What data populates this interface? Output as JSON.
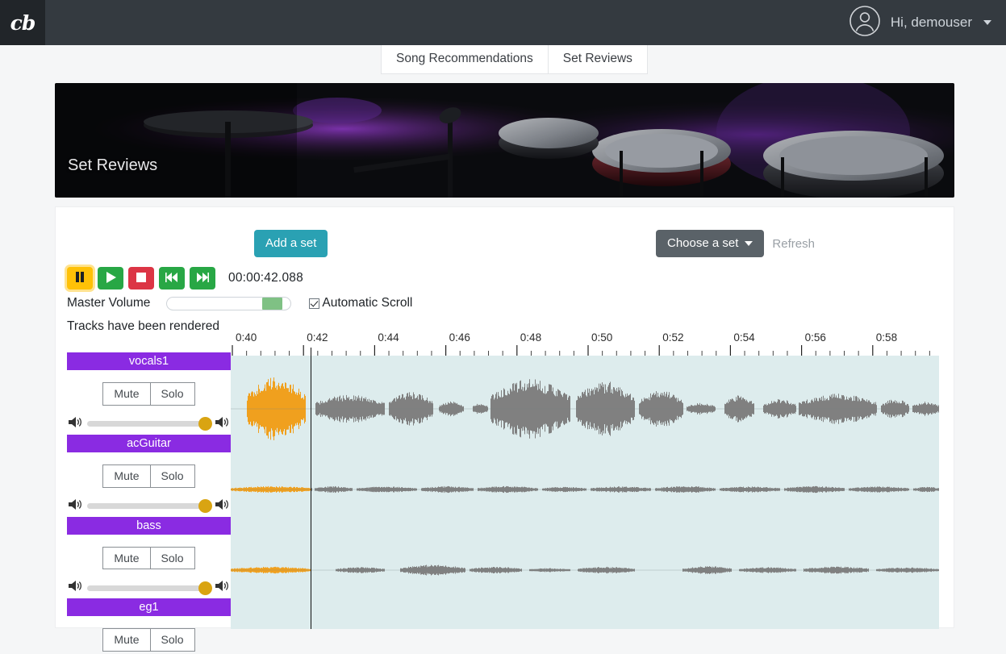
{
  "navbar": {
    "brand": "cb",
    "brand_icon": "cb-logo-icon",
    "avatar_icon": "user-avatar-icon",
    "greeting": "Hi, demouser",
    "caret_icon": "chevron-down-icon"
  },
  "tabs": [
    {
      "label": "Song Recommendations",
      "active": false
    },
    {
      "label": "Set Reviews",
      "active": true
    }
  ],
  "hero": {
    "title": "Set Reviews"
  },
  "toolbar": {
    "add_set_label": "Add a set",
    "choose_set_label": "Choose a set",
    "refresh_label": "Refresh"
  },
  "transport": {
    "pause_icon": "pause-icon",
    "play_icon": "play-icon",
    "stop_icon": "stop-icon",
    "rewind_icon": "rewind-icon",
    "forward_icon": "fast-forward-icon",
    "timecode": "00:00:42.088"
  },
  "controls": {
    "master_volume_label": "Master Volume",
    "master_volume_value": 78,
    "auto_scroll_label": "Automatic Scroll",
    "auto_scroll_checked": true,
    "render_status": "Tracks have been rendered",
    "speaker_left_icon": "speaker-icon",
    "speaker_right_icon": "speaker-icon"
  },
  "timeline": {
    "tick_labels": [
      "0:40",
      "0:42",
      "0:44",
      "0:46",
      "0:48",
      "0:50",
      "0:52",
      "0:54",
      "0:56",
      "0:58"
    ],
    "playhead_time": "0:42",
    "lane_bg_color": "#ddeced",
    "played_color": "#f0a01e",
    "unplayed_color": "#808080",
    "playhead_color": "#111111"
  },
  "tracks": [
    {
      "name": "vocals1",
      "mute_label": "Mute",
      "solo_label": "Solo",
      "volume": 100
    },
    {
      "name": "acGuitar",
      "mute_label": "Mute",
      "solo_label": "Solo",
      "volume": 100
    },
    {
      "name": "bass",
      "mute_label": "Mute",
      "solo_label": "Solo",
      "volume": 100
    },
    {
      "name": "eg1",
      "mute_label": "Mute",
      "solo_label": "Solo",
      "volume": 100
    }
  ],
  "colors": {
    "navbar": "#343a40",
    "track_label": "#8a2be2",
    "add_button": "#2aa1b3",
    "choose_button": "#5a6268",
    "play_button": "#28a745",
    "stop_button": "#dc3545",
    "pause_button": "#ffc107",
    "track_thumb": "#d9a412"
  }
}
